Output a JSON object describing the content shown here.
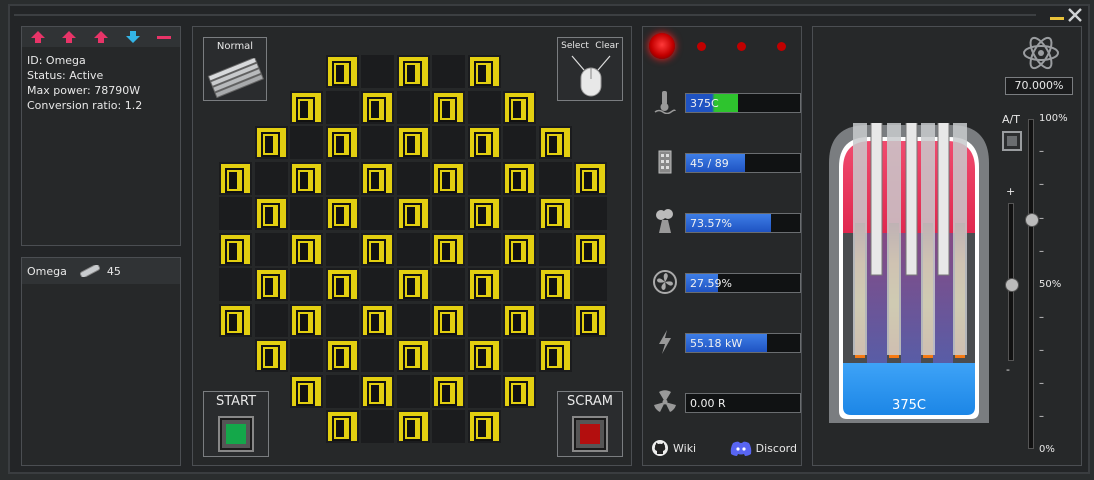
{
  "reactor": {
    "id_line": "ID: Omega",
    "status_line": "Status: Active",
    "max_power_line": "Max power: 78790W",
    "conversion_line": "Conversion ratio: 1.2"
  },
  "list": {
    "item_name": "Omega",
    "item_count": "45"
  },
  "controls": {
    "mode_label": "Normal",
    "select_label": "Select",
    "clear_label": "Clear",
    "start_label": "START",
    "scram_label": "SCRAM"
  },
  "stats": {
    "temperature": {
      "text": "375C",
      "fill": 0.46
    },
    "rods": {
      "text": "45 / 89",
      "fill": 0.51
    },
    "cooling": {
      "text": "73.57%",
      "fill": 0.7357
    },
    "fan": {
      "text": "27.59%",
      "fill": 0.2759
    },
    "power": {
      "text": "55.18 kW",
      "fill": 0.7
    },
    "radiation": {
      "text": "0.00 R",
      "fill": 0
    }
  },
  "links": {
    "wiki": "Wiki",
    "discord": "Discord"
  },
  "vessel": {
    "temp_label": "375C"
  },
  "gauge": {
    "percent": "70.000%",
    "at_label": "A/T",
    "plus": "+",
    "minus": "-",
    "scale_top": "100%",
    "scale_mid": "50%",
    "scale_bottom": "0%",
    "scale_tick": "–"
  },
  "colors": {
    "rod_yellow": "#e3cf10",
    "bar_blue": "#2f68d8",
    "led_red": "#d00000",
    "coolant_blue": "#2b8ff0",
    "hot_pink": "#e83f6a",
    "start_green": "#14a84a",
    "scram_red": "#b30e0e"
  },
  "icons": {
    "up": "arrow-up-icon",
    "down": "arrow-down-icon",
    "remove": "minus-icon",
    "rod": "fuel-rod-icon",
    "thermometer": "thermometer-icon",
    "cooling_tower": "cooling-tower-icon",
    "fan": "fan-icon",
    "bolt": "lightning-icon",
    "radiation": "radiation-icon",
    "github": "github-icon",
    "discord": "discord-icon",
    "atom": "atom-icon"
  }
}
